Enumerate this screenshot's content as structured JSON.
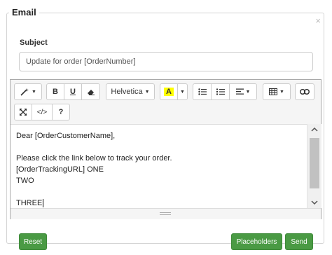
{
  "dialog": {
    "title": "Email",
    "close_glyph": "×"
  },
  "subject": {
    "label": "Subject",
    "value": "Update for order [OrderNumber]"
  },
  "toolbar": {
    "font_name": "Helvetica",
    "bold": "B",
    "underline": "U",
    "code_view": "</>",
    "help": "?",
    "highlight_letter": "A",
    "highlight_color": "#ffff00"
  },
  "body_lines": [
    "Dear [OrderCustomerName],",
    "",
    "Please click the link below to track your order.",
    "[OrderTrackingURL] ONE",
    "TWO",
    "",
    "THREE"
  ],
  "footer": {
    "reset": "Reset",
    "placeholders": "Placeholders",
    "send": "Send"
  },
  "colors": {
    "accent_green": "#4a9a44"
  }
}
